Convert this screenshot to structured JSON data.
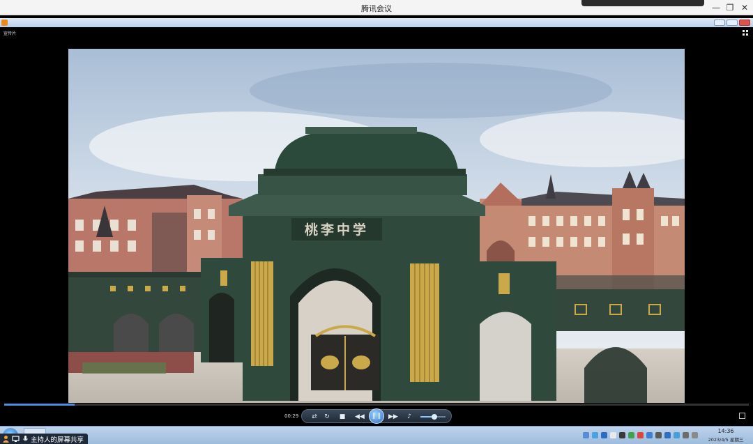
{
  "meeting": {
    "title": "腾讯会议",
    "minimize_icon": "minimize-icon",
    "restore_icon": "restore-icon",
    "close_icon": "close-icon"
  },
  "player": {
    "window_label": "宣传片",
    "elapsed": "00:29",
    "progress": 0.095,
    "volume": 0.55,
    "controls": [
      "shuffle-icon",
      "repeat-icon",
      "stop-icon",
      "previous-icon",
      "pause-icon",
      "next-icon",
      "volume-icon"
    ]
  },
  "video": {
    "gate_plaque": "桃李中学"
  },
  "taskbar": {
    "time": "14:36",
    "date": "2023/4/5 星期三"
  },
  "share": {
    "label": "主持人的屏幕共享"
  },
  "colors": {
    "accent": "#4b8ee6",
    "gate_green": "#2f4a3d",
    "gold": "#c9a94a",
    "brick": "#b9776a"
  }
}
